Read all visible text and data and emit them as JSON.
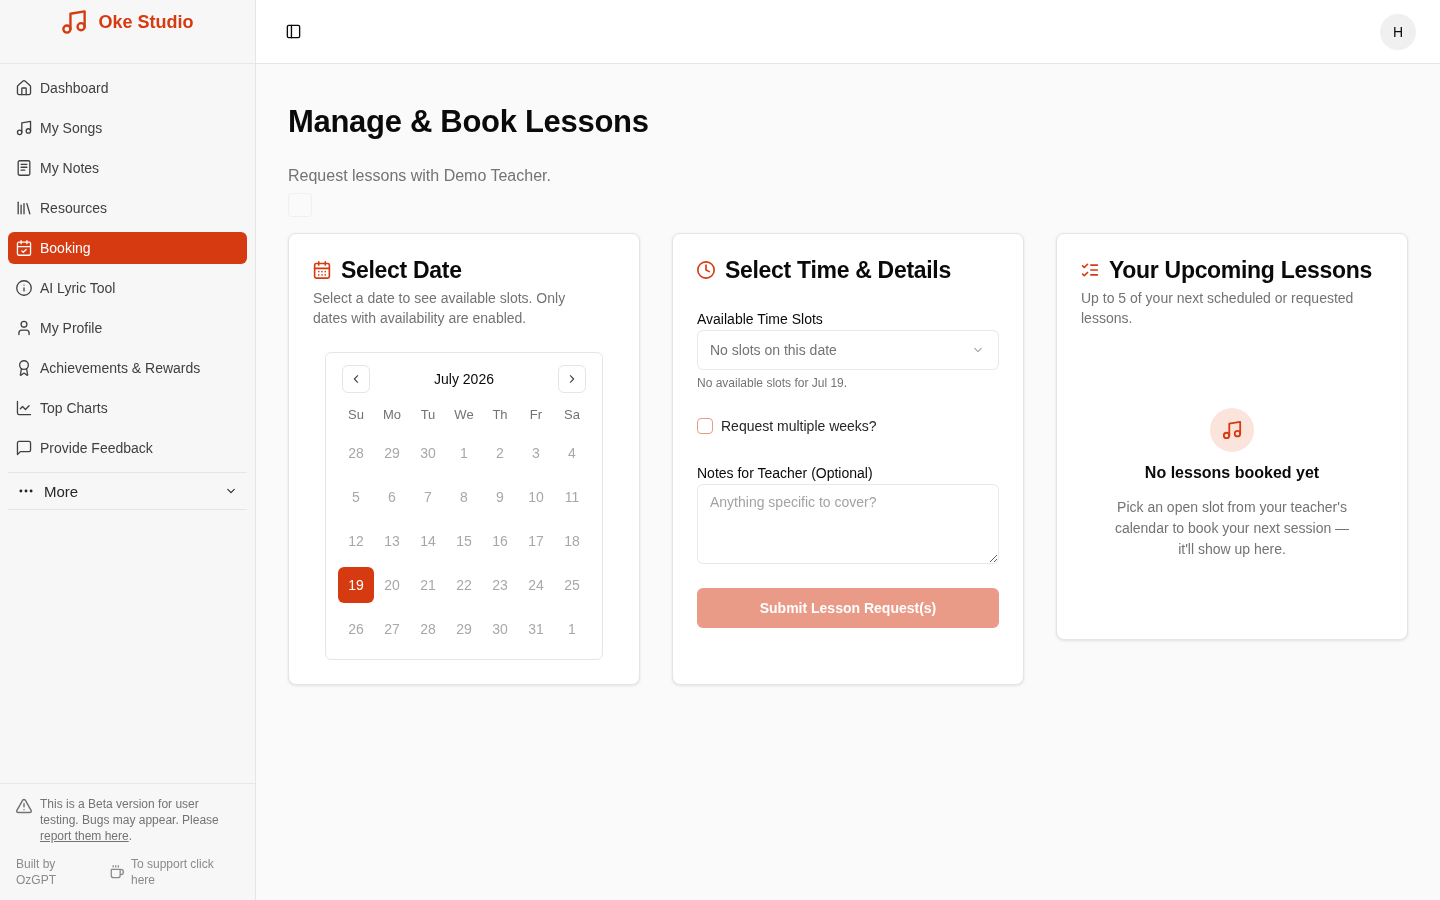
{
  "sidebar": {
    "brand": "Oke Studio",
    "items": [
      {
        "label": "Dashboard",
        "selected": false
      },
      {
        "label": "My Songs",
        "selected": false
      },
      {
        "label": "My Notes",
        "selected": false
      },
      {
        "label": "Resources",
        "selected": false
      },
      {
        "label": "Booking",
        "selected": true
      },
      {
        "label": "AI Lyric Tool",
        "selected": false
      },
      {
        "label": "My Profile",
        "selected": false
      },
      {
        "label": "Achievements & Rewards",
        "selected": false
      },
      {
        "label": "Top Charts",
        "selected": false
      },
      {
        "label": "Provide Feedback",
        "selected": false
      }
    ],
    "more": {
      "label": "More",
      "expanded": false
    },
    "notice": {
      "text": "This is a Beta version for user testing. Bugs may appear. Please",
      "link": "report them here",
      "after": "."
    },
    "credit": "Built by OzGPT",
    "support_link": "To support click here"
  },
  "header": {
    "avatar": "H"
  },
  "page": {
    "title": "Manage & Book Lessons",
    "subtitle": "Request lessons with Demo Teacher."
  },
  "date_card": {
    "title": "Select Date",
    "description": "Select a date to see available slots. Only dates with availability are enabled.",
    "calendar": {
      "month": "July 2026",
      "weekdays": [
        "Su",
        "Mo",
        "Tu",
        "We",
        "Th",
        "Fr",
        "Sa"
      ],
      "weeks": [
        [
          {
            "label": "28",
            "selected": false,
            "disabled": true
          },
          {
            "label": "29",
            "selected": false,
            "disabled": true
          },
          {
            "label": "30",
            "selected": false,
            "disabled": true
          },
          {
            "label": "1",
            "selected": false,
            "disabled": true
          },
          {
            "label": "2",
            "selected": false,
            "disabled": true
          },
          {
            "label": "3",
            "selected": false,
            "disabled": true
          },
          {
            "label": "4",
            "selected": false,
            "disabled": true
          }
        ],
        [
          {
            "label": "5",
            "selected": false,
            "disabled": true
          },
          {
            "label": "6",
            "selected": false,
            "disabled": true
          },
          {
            "label": "7",
            "selected": false,
            "disabled": true
          },
          {
            "label": "8",
            "selected": false,
            "disabled": true
          },
          {
            "label": "9",
            "selected": false,
            "disabled": true
          },
          {
            "label": "10",
            "selected": false,
            "disabled": true
          },
          {
            "label": "11",
            "selected": false,
            "disabled": true
          }
        ],
        [
          {
            "label": "12",
            "selected": false,
            "disabled": true
          },
          {
            "label": "13",
            "selected": false,
            "disabled": true
          },
          {
            "label": "14",
            "selected": false,
            "disabled": true
          },
          {
            "label": "15",
            "selected": false,
            "disabled": true
          },
          {
            "label": "16",
            "selected": false,
            "disabled": true
          },
          {
            "label": "17",
            "selected": false,
            "disabled": true
          },
          {
            "label": "18",
            "selected": false,
            "disabled": true
          }
        ],
        [
          {
            "label": "19",
            "selected": true,
            "disabled": false
          },
          {
            "label": "20",
            "selected": false,
            "disabled": true
          },
          {
            "label": "21",
            "selected": false,
            "disabled": true
          },
          {
            "label": "22",
            "selected": false,
            "disabled": true
          },
          {
            "label": "23",
            "selected": false,
            "disabled": true
          },
          {
            "label": "24",
            "selected": false,
            "disabled": true
          },
          {
            "label": "25",
            "selected": false,
            "disabled": true
          }
        ],
        [
          {
            "label": "26",
            "selected": false,
            "disabled": true
          },
          {
            "label": "27",
            "selected": false,
            "disabled": true
          },
          {
            "label": "28",
            "selected": false,
            "disabled": true
          },
          {
            "label": "29",
            "selected": false,
            "disabled": true
          },
          {
            "label": "30",
            "selected": false,
            "disabled": true
          },
          {
            "label": "31",
            "selected": false,
            "disabled": true
          },
          {
            "label": "1",
            "selected": false,
            "disabled": true
          }
        ]
      ]
    }
  },
  "time_card": {
    "title": "Select Time & Details",
    "slots_label": "Available Time Slots",
    "slots_select": {
      "placeholder": "No slots on this date"
    },
    "slots_hint": "No available slots for Jul 19.",
    "repeat_checkbox": {
      "label": "Request multiple weeks?",
      "checked": false
    },
    "notes_label": "Notes for Teacher (Optional)",
    "notes_field": {
      "placeholder": "Anything specific to cover?"
    },
    "submit_button": {
      "label": "Submit Lesson Request(s)",
      "disabled": true
    }
  },
  "lessons_card": {
    "title": "Your Upcoming Lessons",
    "description": "Up to 5 of your next scheduled or requested lessons.",
    "empty_state": {
      "title": "No lessons booked yet",
      "text": "Pick an open slot from your teacher's calendar to book your next session — it'll show up here."
    }
  }
}
